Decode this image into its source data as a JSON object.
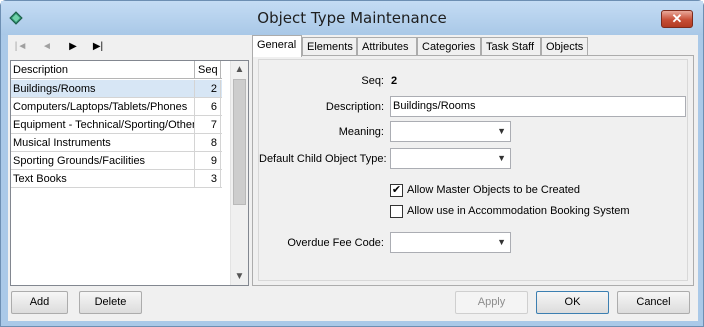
{
  "window": {
    "title": "Object Type Maintenance",
    "close_symbol": "✕"
  },
  "nav": {
    "first": "|◄",
    "prev": "◄",
    "next": "▶",
    "last": "▶|"
  },
  "list": {
    "headers": {
      "description": "Description",
      "seq": "Seq"
    },
    "rows": [
      {
        "description": "Buildings/Rooms",
        "seq": "2",
        "selected": true
      },
      {
        "description": "Computers/Laptops/Tablets/Phones",
        "seq": "6"
      },
      {
        "description": "Equipment - Technical/Sporting/Other",
        "seq": "7"
      },
      {
        "description": "Musical Instruments",
        "seq": "8"
      },
      {
        "description": "Sporting Grounds/Facilities",
        "seq": "9"
      },
      {
        "description": "Text Books",
        "seq": "3"
      }
    ]
  },
  "tabs": [
    "General",
    "Elements",
    "Attributes",
    "Categories",
    "Task Staff",
    "Objects"
  ],
  "form": {
    "seq_label": "Seq:",
    "seq_value": "2",
    "description_label": "Description:",
    "description_value": "Buildings/Rooms",
    "meaning_label": "Meaning:",
    "meaning_value": "",
    "default_child_label": "Default Child Object Type:",
    "default_child_value": "",
    "allow_master_label": "Allow Master Objects to be Created",
    "allow_master_checked": true,
    "allow_accommodation_label": "Allow use in Accommodation Booking System",
    "allow_accommodation_checked": false,
    "overdue_fee_label": "Overdue Fee Code:",
    "overdue_fee_value": ""
  },
  "buttons": {
    "add": "Add",
    "delete": "Delete",
    "apply": "Apply",
    "ok": "OK",
    "cancel": "Cancel"
  },
  "colors": {
    "title_bar": "#aac9e8",
    "selected_row": "#d7e6f5",
    "close_button": "#c74e36"
  }
}
